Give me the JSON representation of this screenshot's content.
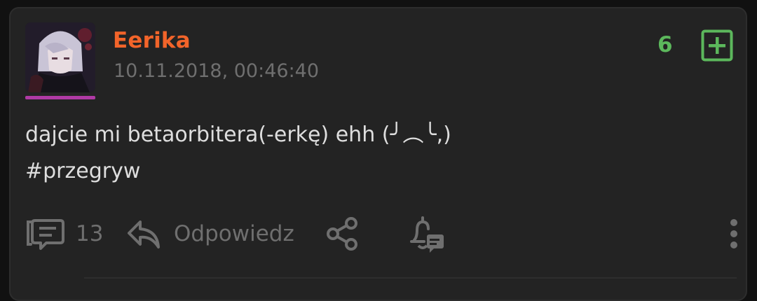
{
  "post": {
    "username": "Eerika",
    "timestamp": "10.11.2018, 00:46:40",
    "votes": "6",
    "content_line1": "dajcie mi betaorbitera(-erkę) ehh (╯︵╰,)",
    "content_line2": "#przegryw"
  },
  "actions": {
    "comments_count": "13",
    "reply_label": "Odpowiedz"
  },
  "icons": {
    "avatar": "avatar-image",
    "vote": "plus-square-icon",
    "comments": "comments-icon",
    "reply": "reply-icon",
    "share": "share-icon",
    "notify": "bell-notification-icon",
    "more": "more-vertical-icon"
  },
  "colors": {
    "username": "#f2642a",
    "vote": "#5cb85c",
    "avatar_bar": "#b03aa5",
    "muted": "#6f6f6f",
    "text": "#dedede"
  }
}
